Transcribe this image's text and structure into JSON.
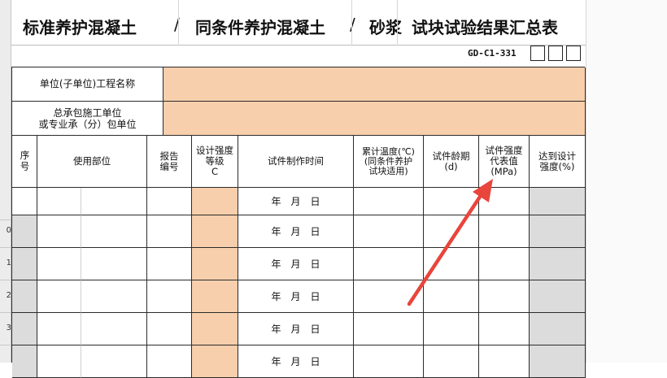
{
  "title": {
    "part1": "标准养护混凝土",
    "sep1": "/",
    "part2": "同条件养护混凝土",
    "sep2": "/",
    "part3": "砂浆",
    "part4": "试块试验结果汇总表"
  },
  "form_code": "GD-C1-331",
  "info_rows": [
    {
      "label": "单位(子单位)工程名称",
      "value": ""
    },
    {
      "label_line1": "总承包施工单位",
      "label_line2": "或专业承（分）包单位",
      "value": ""
    }
  ],
  "columns": {
    "seq": "序号",
    "location": "使用部位",
    "report_no_line1": "报告",
    "report_no_line2": "编号",
    "design_grade_line1": "设计强度",
    "design_grade_line2": "等级",
    "design_grade_line3": "C",
    "make_time": "试件制作时间",
    "temp_line1": "累计温度(℃)",
    "temp_line2": "(同条件养护",
    "temp_line3": "试块适用)",
    "age_line1": "试件龄期",
    "age_line2": "(d)",
    "rep_line1": "试件强度",
    "rep_line2": "代表值",
    "rep_line3": "(MPa)",
    "reach_line1": "达到设计",
    "reach_line2": "强度(%)"
  },
  "row_headers": [
    "",
    "0",
    "1",
    "2",
    "3",
    ""
  ],
  "date_units": {
    "year": "年",
    "month": "月",
    "day": "日"
  },
  "colors": {
    "peach": "#f7cfac",
    "grey": "#dcdcdc",
    "arrow": "#e8453c"
  }
}
